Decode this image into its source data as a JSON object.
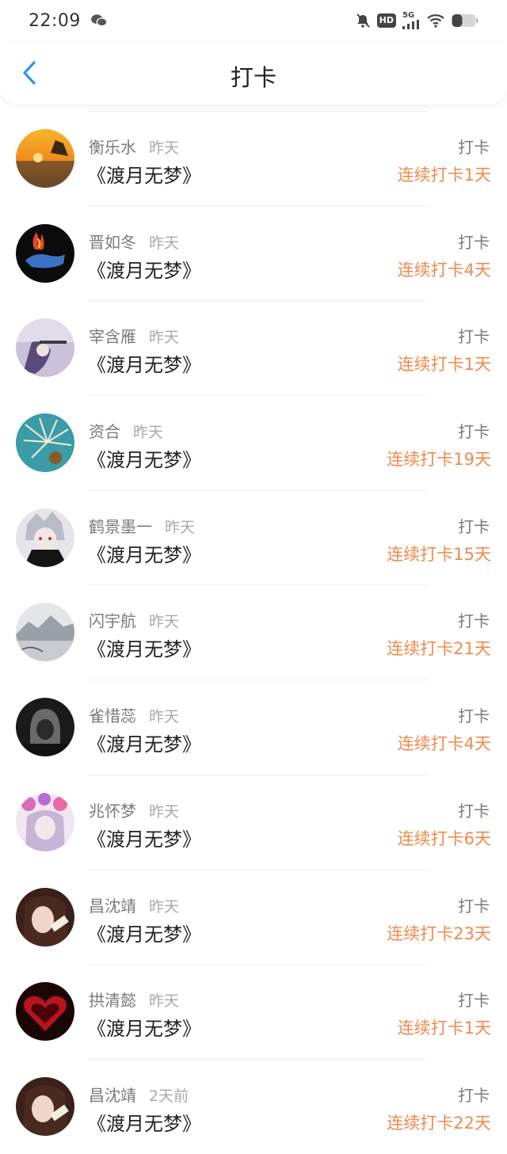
{
  "status_bar": {
    "time": "22:09",
    "network": "5G",
    "hd": "HD",
    "icons": [
      "wechat-icon",
      "mute-bell-icon",
      "hd-icon",
      "signal-5g-icon",
      "wifi-icon",
      "battery-icon"
    ]
  },
  "header": {
    "title": "打卡",
    "back_icon": "chevron-left-icon"
  },
  "colors": {
    "accent": "#2a98e6",
    "streak": "#f08a4b",
    "secondary_text": "#7a7a7a"
  },
  "records": [
    {
      "name": "衡乐水",
      "time": "昨天",
      "book": "《渡月无梦》",
      "action": "打卡",
      "streak": "连续打卡1天"
    },
    {
      "name": "晋如冬",
      "time": "昨天",
      "book": "《渡月无梦》",
      "action": "打卡",
      "streak": "连续打卡4天"
    },
    {
      "name": "宰含雁",
      "time": "昨天",
      "book": "《渡月无梦》",
      "action": "打卡",
      "streak": "连续打卡1天"
    },
    {
      "name": "资合",
      "time": "昨天",
      "book": "《渡月无梦》",
      "action": "打卡",
      "streak": "连续打卡19天"
    },
    {
      "name": "鹤景墨一",
      "time": "昨天",
      "book": "《渡月无梦》",
      "action": "打卡",
      "streak": "连续打卡15天"
    },
    {
      "name": "闪宇航",
      "time": "昨天",
      "book": "《渡月无梦》",
      "action": "打卡",
      "streak": "连续打卡21天"
    },
    {
      "name": "雀惜蕊",
      "time": "昨天",
      "book": "《渡月无梦》",
      "action": "打卡",
      "streak": "连续打卡4天"
    },
    {
      "name": "兆怀梦",
      "time": "昨天",
      "book": "《渡月无梦》",
      "action": "打卡",
      "streak": "连续打卡6天"
    },
    {
      "name": "昌沈靖",
      "time": "昨天",
      "book": "《渡月无梦》",
      "action": "打卡",
      "streak": "连续打卡23天"
    },
    {
      "name": "拱清懿",
      "time": "昨天",
      "book": "《渡月无梦》",
      "action": "打卡",
      "streak": "连续打卡1天"
    },
    {
      "name": "昌沈靖",
      "time": "2天前",
      "book": "《渡月无梦》",
      "action": "打卡",
      "streak": "连续打卡22天"
    }
  ]
}
